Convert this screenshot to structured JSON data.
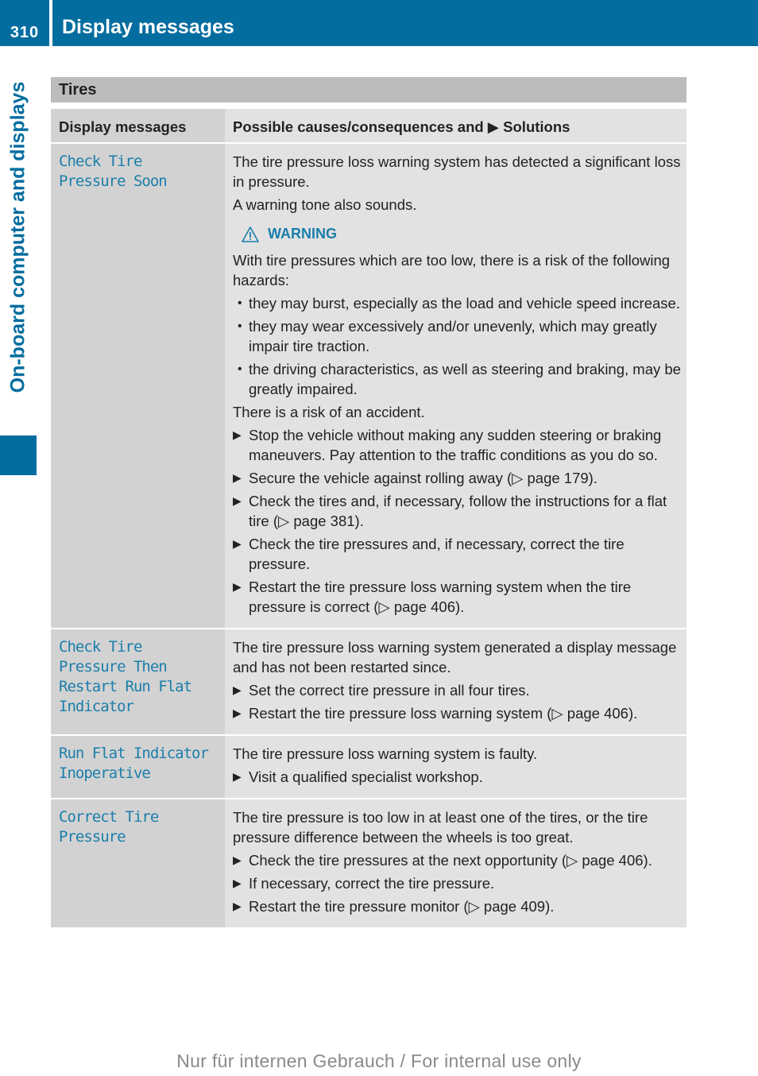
{
  "header": {
    "page_number": "310",
    "title": "Display messages"
  },
  "side_tab": {
    "label": "On-board computer and displays"
  },
  "section": {
    "title": "Tires"
  },
  "table": {
    "columns": [
      "Display messages",
      "Possible causes/consequences and ▶ Solutions"
    ],
    "rows": [
      {
        "message": "Check Tire Pressure Soon",
        "message_lines": [
          "Check Tire",
          "Pressure Soon"
        ],
        "paragraphs_before": [
          "The tire pressure loss warning system has detected a significant loss in pressure.",
          "A warning tone also sounds."
        ],
        "warning": {
          "label": "WARNING",
          "text": "With tire pressures which are too low, there is a risk of the following hazards:",
          "bullets": [
            "they may burst, especially as the load and vehicle speed increase.",
            "they may wear excessively and/or unevenly, which may greatly impair tire traction.",
            "the driving characteristics, as well as steering and braking, may be greatly impaired."
          ],
          "conclusion": "There is a risk of an accident."
        },
        "steps": [
          "Stop the vehicle without making any sudden steering or braking maneuvers. Pay attention to the traffic conditions as you do so.",
          "Secure the vehicle against rolling away (▷ page 179).",
          "Check the tires and, if necessary, follow the instructions for a flat tire (▷ page 381).",
          "Check the tire pressures and, if necessary, correct the tire pressure.",
          "Restart the tire pressure loss warning system when the tire pressure is correct (▷ page 406)."
        ]
      },
      {
        "message": "Check Tire Pressure Then Restart Run Flat Indicator",
        "message_lines": [
          "Check Tire",
          "Pressure Then",
          "Restart Run Flat",
          "Indicator"
        ],
        "paragraphs_before": [
          "The tire pressure loss warning system generated a display message and has not been restarted since."
        ],
        "steps": [
          "Set the correct tire pressure in all four tires.",
          "Restart the tire pressure loss warning system (▷ page 406)."
        ]
      },
      {
        "message": "Run Flat Indicator Inoperative",
        "message_lines": [
          "Run Flat Indicator",
          "Inoperative"
        ],
        "paragraphs_before": [
          "The tire pressure loss warning system is faulty."
        ],
        "steps": [
          "Visit a qualified specialist workshop."
        ]
      },
      {
        "message": "Correct Tire Pressure",
        "message_lines": [
          "Correct Tire",
          "Pressure"
        ],
        "paragraphs_before": [
          "The tire pressure is too low in at least one of the tires, or the tire pressure difference between the wheels is too great."
        ],
        "steps": [
          "Check the tire pressures at the next opportunity (▷ page 406).",
          "If necessary, correct the tire pressure.",
          "Restart the tire pressure monitor (▷ page 409)."
        ]
      }
    ]
  },
  "icons": {
    "warning": "warning-triangle-icon",
    "step": "triangle-right-icon",
    "bullet": "bullet-dot"
  },
  "glyphs": {
    "step_marker": "▶",
    "bullet_marker": "•"
  },
  "colors": {
    "brand_blue": "#046d9f",
    "message_blue": "#1b7eab",
    "section_gray": "#bcbcbc",
    "msg_col_gray": "#d2d2d2",
    "desc_col_gray": "#e2e2e2"
  },
  "footer": {
    "text": "Nur für internen Gebrauch / For internal use only"
  }
}
